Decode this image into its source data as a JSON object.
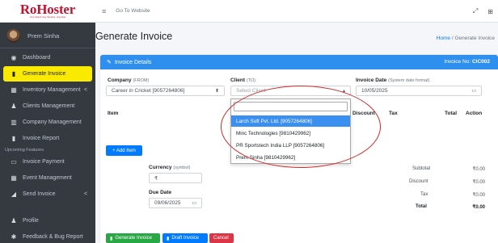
{
  "brand": {
    "name": "RoHoster",
    "tagline": "Any Cloud, Any Service, Any App"
  },
  "user": {
    "name": "Prem Sinha"
  },
  "sidebar": {
    "items": [
      {
        "label": "Dashboard",
        "icon": "dashboard-icon",
        "glyph": "◉"
      },
      {
        "label": "Generate Invoice",
        "icon": "file-icon",
        "glyph": "▮",
        "active": true
      },
      {
        "label": "Inventory Management",
        "icon": "boxes-icon",
        "glyph": "▦",
        "chevron": "<"
      },
      {
        "label": "Clients Management",
        "icon": "users-icon",
        "glyph": "♟"
      },
      {
        "label": "Company Management",
        "icon": "building-icon",
        "glyph": "▥"
      },
      {
        "label": "Invoice Report",
        "icon": "file-icon",
        "glyph": "▮"
      }
    ],
    "section_header": "Upcoming Features",
    "upcoming": [
      {
        "label": "Invoice Payment",
        "icon": "card-icon",
        "glyph": "▭"
      },
      {
        "label": "Event Management",
        "icon": "calendar-icon",
        "glyph": "▦"
      },
      {
        "label": "Send Invoice",
        "icon": "send-icon",
        "glyph": "◢",
        "chevron": "<"
      }
    ],
    "bottom": [
      {
        "label": "Profile",
        "icon": "user-icon",
        "glyph": "♟"
      },
      {
        "label": "Feedback & Bug Report",
        "icon": "bug-icon",
        "glyph": "✱"
      }
    ]
  },
  "topbar": {
    "goto": "Go To Website",
    "menu_glyph": "≡",
    "expand_glyph": "⤢",
    "grid_glyph": "⊞"
  },
  "page": {
    "title": "Generate Invoice",
    "breadcrumb_home": "Home",
    "breadcrumb_sep": "/",
    "breadcrumb_current": "Generate Invoice"
  },
  "card": {
    "title": "Invoice Details",
    "invoice_no_label": "Invoice No:",
    "invoice_no": "CIC002"
  },
  "form": {
    "company_label": "Company",
    "company_sub": "(FROM)",
    "company_value": "Career in Cricket [9057264806]",
    "client_label": "Client",
    "client_sub": "(TO)",
    "client_placeholder": "Select Client",
    "date_label": "Invoice Date",
    "date_sub": "(System date format)",
    "date_value": "10/05/2025",
    "currency_label": "Currency",
    "currency_sub": "(symbol)",
    "currency_value": "₹",
    "due_label": "Due Date",
    "due_value": "09/06/2025"
  },
  "table": {
    "item": "Item",
    "discount": "Discount",
    "tax": "Tax",
    "total": "Total",
    "action": "Action"
  },
  "buttons": {
    "add_item": "+ Add Item",
    "generate": "Generate Invoice",
    "draft": "Draft Invoice",
    "cancel": "Cancel"
  },
  "totals": [
    {
      "label": "Subtotal",
      "value": "₹0.00"
    },
    {
      "label": "Discount",
      "value": "₹0.00"
    },
    {
      "label": "Tax",
      "value": "₹0.00"
    },
    {
      "label": "Total",
      "value": "₹0.00",
      "bold": true
    }
  ],
  "client_options": [
    "Larch Soft Pvt. Ltd. [9057264806]",
    "Minc Technologies [9810429962]",
    "PR Sportstech India LLP [9057264806]",
    "Prem Sinha [9810429962]"
  ],
  "colors": {
    "accent": "#2f8fef",
    "active": "#f9ea00",
    "sidebar": "#343a40",
    "brand": "#c8102e",
    "annotation": "#d62828"
  }
}
